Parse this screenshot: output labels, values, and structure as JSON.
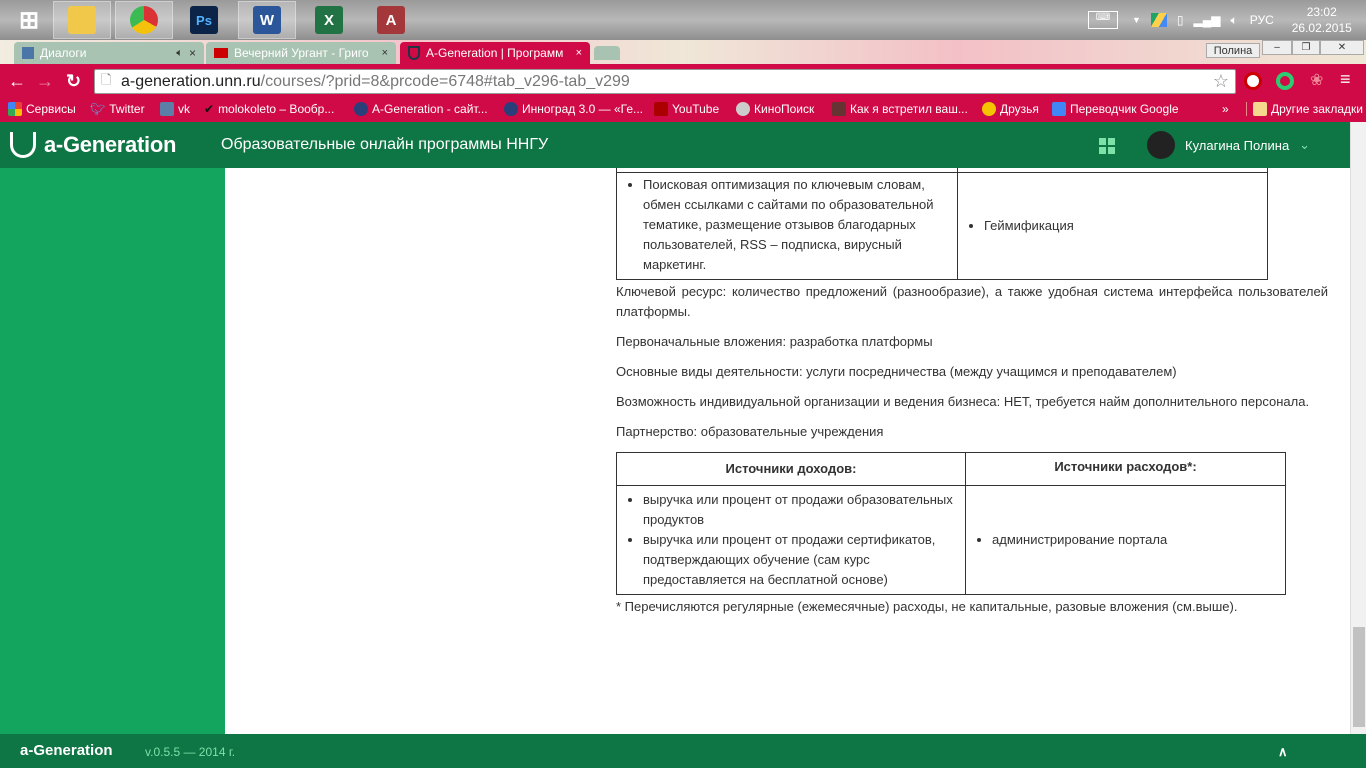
{
  "taskbar": {
    "apps": [
      "Windows",
      "Explorer",
      "Chrome",
      "Photoshop",
      "Word",
      "Excel",
      "Access"
    ],
    "lang": "РУС",
    "time": "23:02",
    "date": "26.02.2015"
  },
  "browser": {
    "tabs": [
      {
        "label": "Диалоги"
      },
      {
        "label": "Вечерний Ургант - Григо"
      },
      {
        "label": "A-Generation | Программ"
      }
    ],
    "profile": "Полина",
    "url_host": "a-generation.unn.ru",
    "url_path": "/courses/?prid=8&prcode=6748#tab_v296-tab_v299",
    "bookmarks": [
      "Сервисы",
      "Twitter",
      "vk",
      "molokoleto – Вообр...",
      "A-Generation - сайт...",
      "Инноград 3.0 — «Ге...",
      "YouTube",
      "КиноПоиск",
      "Как я встретил ваш...",
      "Друзья",
      "Переводчик Google"
    ],
    "more": "»",
    "other_bookmarks": "Другие закладки"
  },
  "app": {
    "logo": "a-Generation",
    "subtitle": "Образовательные онлайн программы ННГУ",
    "user": "Кулагина Полина"
  },
  "content": {
    "table1": {
      "left_items": [
        "Поисковая оптимизация по ключевым словам, обмен ссылками с сайтами по образовательной тематике, размещение отзывов благодарных пользователей, RSS – подписка, вирусный маркетинг."
      ],
      "right_items": [
        "Геймификация"
      ]
    },
    "paragraphs": [
      "Ключевой ресурс: количество предложений (разнообразие), а также удобная система интерфейса пользователей платформы.",
      "Первоначальные вложения: разработка платформы",
      "Основные виды деятельности: услуги посредничества (между учащимся и преподавателем)",
      "Возможность индивидуальной организации и ведения бизнеса: НЕТ, требуется найм дополнительного персонала.",
      "Партнерство: образовательные учреждения"
    ],
    "table2": {
      "header_left": "Источники доходов:",
      "header_right": "Источники расходов*:",
      "left_items": [
        "выручка или процент от продажи образовательных продуктов",
        "выручка или процент от продажи сертификатов, подтверждающих обучение (сам курс предоставляется на бесплатной основе)"
      ],
      "right_items": [
        "администрирование портала"
      ]
    },
    "footnote": "* Перечисляются регулярные (ежемесячные) расходы, не капитальные, разовые вложения (см.выше)."
  },
  "footer": {
    "logo": "a-Generation",
    "version": "v.0.5.5 — 2014 г.",
    "up": "∧"
  }
}
